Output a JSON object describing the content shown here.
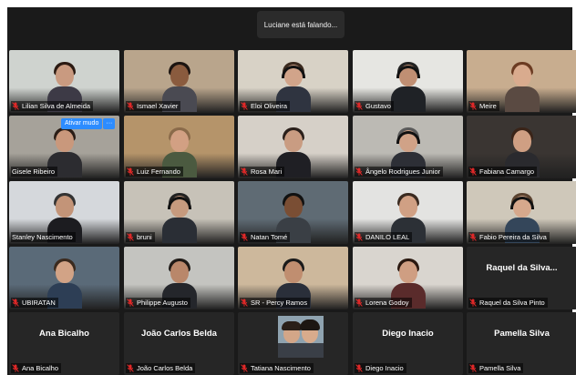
{
  "speaker_banner": "Luciane está falando...",
  "mute_popup": {
    "mute_label": "Ativar mudo",
    "more_label": "···"
  },
  "tiles": [
    {
      "name": "Lilian Silva de Almeida",
      "bg": "#cfd3cf",
      "skin": "#c99a80",
      "hair": "#2b1a12",
      "shirt": "#3d3a46",
      "muted": true,
      "headphones": false
    },
    {
      "name": "Ismael Xavier",
      "bg": "#b9a58c",
      "skin": "#8a5b3e",
      "hair": "#1c1410",
      "shirt": "#4a4a52",
      "muted": true,
      "headphones": false
    },
    {
      "name": "Eloi Oliveira",
      "bg": "#d8d2c6",
      "skin": "#d1a48a",
      "hair": "#3b2a1e",
      "shirt": "#2f3440",
      "muted": true,
      "headphones": true
    },
    {
      "name": "Gustavo",
      "bg": "#e6e6e2",
      "skin": "#c08f73",
      "hair": "#222",
      "shirt": "#1f2226",
      "muted": true,
      "headphones": true
    },
    {
      "name": "Meire",
      "bg": "#c8ad8f",
      "skin": "#d9ab8e",
      "hair": "#6b3b22",
      "shirt": "#5a4a42",
      "muted": true,
      "headphones": false
    },
    {
      "name": "Gisele Ribeiro",
      "bg": "#a6a29a",
      "skin": "#c9987c",
      "hair": "#2a1d16",
      "shirt": "#2c2c30",
      "muted": false,
      "headphones": false
    },
    {
      "name": "Luiz Fernando",
      "bg": "#b5946a",
      "skin": "#d2a083",
      "hair": "#8a6a4a",
      "shirt": "#4b5a40",
      "muted": true,
      "headphones": false
    },
    {
      "name": "Rosa Mari",
      "bg": "#d6d0c8",
      "skin": "#c99c82",
      "hair": "#2a1f1a",
      "shirt": "#1f1f24",
      "muted": true,
      "headphones": false
    },
    {
      "name": "Ângelo Rodrigues Junior",
      "bg": "#bcbab4",
      "skin": "#d0a287",
      "hair": "#5a5a5a",
      "shirt": "#2d2f36",
      "muted": true,
      "headphones": true
    },
    {
      "name": "Fabiana Camargo",
      "bg": "#3a3532",
      "skin": "#cf9f83",
      "hair": "#3a2418",
      "shirt": "#2a2a2e",
      "muted": true,
      "headphones": false
    },
    {
      "name": "Stanley Nascimento",
      "bg": "#d5d8dc",
      "skin": "#c39478",
      "hair": "#333",
      "shirt": "#1c1c20",
      "muted": false,
      "headphones": false
    },
    {
      "name": "bruni",
      "bg": "#c7c2b8",
      "skin": "#c69a7e",
      "hair": "#222",
      "shirt": "#2a2e35",
      "muted": true,
      "headphones": true
    },
    {
      "name": "Natan Tomé",
      "bg": "#5f6b74",
      "skin": "#7a4e34",
      "hair": "#111",
      "shirt": "#3a3f45",
      "muted": true,
      "headphones": false
    },
    {
      "name": "DANILO LEAL",
      "bg": "#e3e3e1",
      "skin": "#d0a084",
      "hair": "#3a2a20",
      "shirt": "#2c3036",
      "muted": true,
      "headphones": false
    },
    {
      "name": "Fabio Pereira da Silva",
      "bg": "#cfc8ba",
      "skin": "#d6a88c",
      "hair": "#5b4330",
      "shirt": "#34465a",
      "muted": true,
      "headphones": true
    },
    {
      "name": "UBIRATAN",
      "bg": "#5a6a78",
      "skin": "#d2a386",
      "hair": "#3b2a1e",
      "shirt": "#2d3e55",
      "muted": true,
      "headphones": false
    },
    {
      "name": "Philippe Augusto",
      "bg": "#c4c4c0",
      "skin": "#b9876a",
      "hair": "#1f1a16",
      "shirt": "#24262b",
      "muted": true,
      "headphones": false
    },
    {
      "name": "SR - Percy Ramos",
      "bg": "#cdb89c",
      "skin": "#c08e70",
      "hair": "#1a1a1a",
      "shirt": "#2a2f3a",
      "muted": true,
      "headphones": false
    },
    {
      "name": "Lorena Godoy",
      "bg": "#d9d5cf",
      "skin": "#cf9e82",
      "hair": "#2a1810",
      "shirt": "#5a2b2b",
      "muted": true,
      "headphones": false
    }
  ],
  "text_tiles": [
    {
      "big": "Raquel da Silva...",
      "name": "Raquel da Silva Pinto",
      "muted": true
    },
    {
      "big": "Ana Bicalho",
      "name": "Ana Bicalho",
      "muted": true
    },
    {
      "big": "João Carlos Belda",
      "name": "João Carlos Belda",
      "muted": true
    },
    {
      "big": "",
      "name": "Tatiana Nascimento",
      "muted": true
    },
    {
      "big": "Diego Inacio",
      "name": "Diego Inacio",
      "muted": true
    },
    {
      "big": "Pamella Silva",
      "name": "Pamella Silva",
      "muted": true
    }
  ],
  "colors": {
    "muted_mic": "#e02828",
    "accent": "#2d8cff"
  }
}
